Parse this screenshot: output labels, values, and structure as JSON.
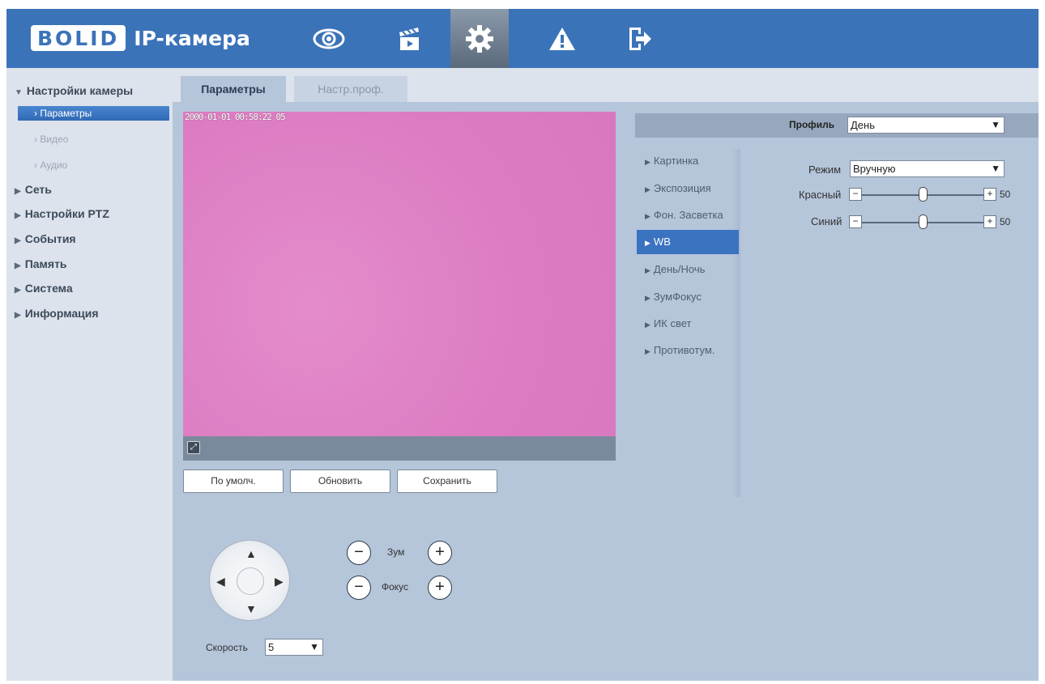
{
  "header": {
    "logo_brand": "BOLID",
    "logo_title": "IP-камера",
    "nav": [
      {
        "name": "live-view",
        "icon": "eye-icon"
      },
      {
        "name": "playback",
        "icon": "clapperboard-icon"
      },
      {
        "name": "settings",
        "icon": "gear-icon",
        "active": true
      },
      {
        "name": "alarm",
        "icon": "warning-icon"
      },
      {
        "name": "logout",
        "icon": "exit-icon"
      }
    ]
  },
  "sidebar": {
    "camera_settings": "Настройки камеры",
    "sub_items": [
      "Параметры",
      "Видео",
      "Аудио"
    ],
    "sections": [
      "Сеть",
      "Настройки PTZ",
      "События",
      "Память",
      "Система",
      "Информация"
    ]
  },
  "tabs": [
    "Параметры",
    "Настр.проф."
  ],
  "video": {
    "osd_timestamp": "2000-01-01 00:58:22 05"
  },
  "buttons": {
    "default": "По умолч.",
    "refresh": "Обновить",
    "save": "Сохранить"
  },
  "ptz": {
    "zoom_label": "Зум",
    "focus_label": "Фокус",
    "speed_label": "Скорость",
    "speed_value": "5"
  },
  "profile": {
    "label": "Профиль",
    "value": "День"
  },
  "menu": [
    "Картинка",
    "Экспозиция",
    "Фон. Засветка",
    "WB",
    "День/Ночь",
    "ЗумФокус",
    "ИК свет",
    "Противотум."
  ],
  "wb": {
    "mode_label": "Режим",
    "mode_value": "Вручную",
    "red_label": "Красный",
    "red_value": "50",
    "blue_label": "Синий",
    "blue_value": "50"
  },
  "colors": {
    "header_bg": "#3b73b9",
    "content_bg": "#b5c5da",
    "active_item": "#3a73c0",
    "video_pink": "#de7fc4"
  }
}
